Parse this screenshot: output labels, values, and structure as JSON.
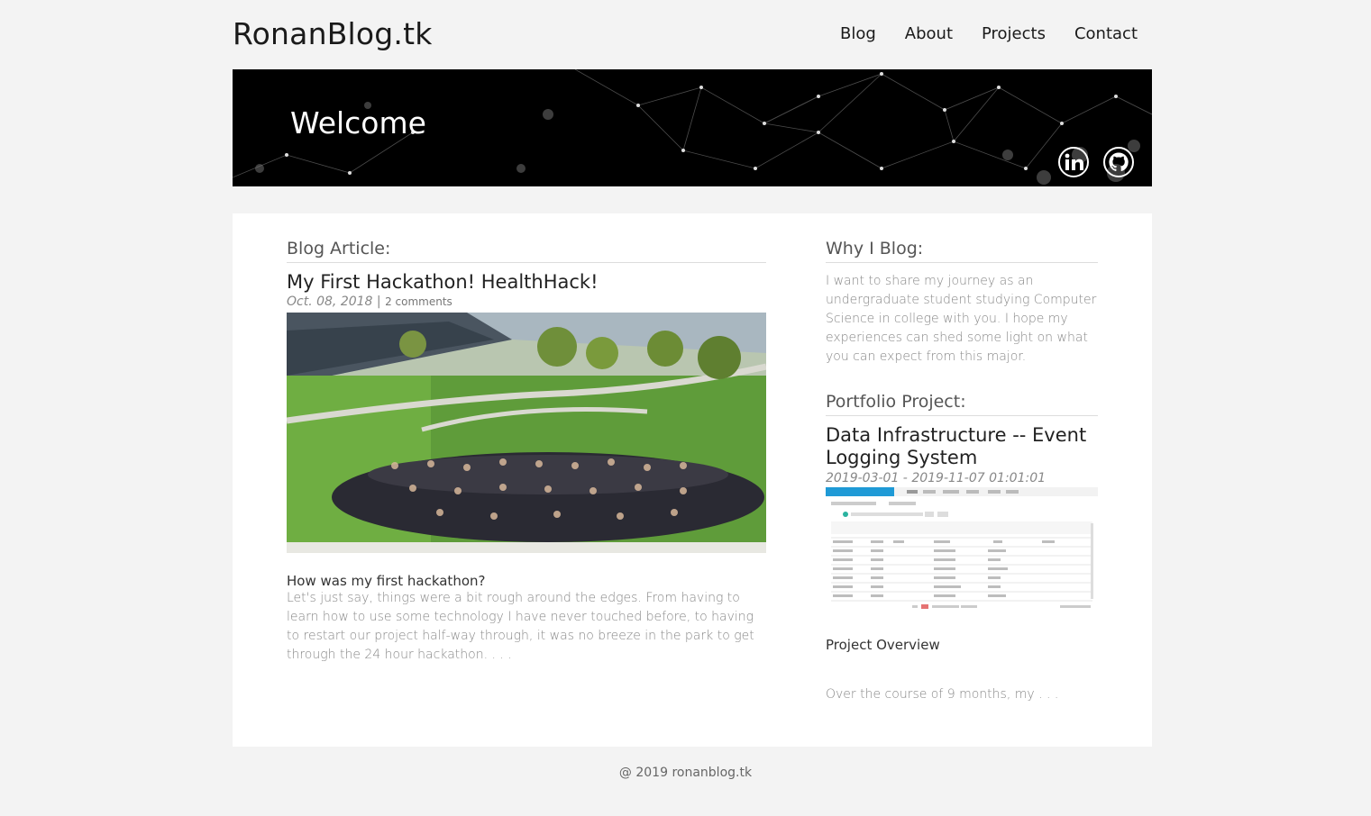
{
  "header": {
    "site_title": "RonanBlog.tk",
    "nav": [
      "Blog",
      "About",
      "Projects",
      "Contact"
    ]
  },
  "hero": {
    "title": "Welcome",
    "social": [
      "linkedin-icon",
      "github-icon"
    ]
  },
  "blog": {
    "section_label": "Blog Article:",
    "title": "My First Hackathon! HealthHack!",
    "date": "Oct. 08, 2018",
    "separator": "|",
    "comments": "2 comments",
    "subheading": "How was my first hackathon?",
    "excerpt": "Let's just say, things were a bit rough around the edges. From having to learn how to use some technology I have never touched before, to having to restart our project half-way through, it was no breeze in the park to get through the 24 hour hackathon. . . ."
  },
  "sidebar": {
    "why_label": "Why I Blog:",
    "why_text": "I want to share my journey as an undergraduate student studying Computer Science in college with you. I hope my experiences can shed some light on what you can expect from this major.",
    "portfolio_label": "Portfolio Project:",
    "project_title": "Data Infrastructure -- Event Logging System",
    "project_date": "2019-03-01 - 2019-11-07 01:01:01",
    "overview_label": "Project Overview",
    "overview_text": "Over the course of 9 months, my . . ."
  },
  "footer": {
    "text": "@ 2019 ronanblog.tk"
  }
}
